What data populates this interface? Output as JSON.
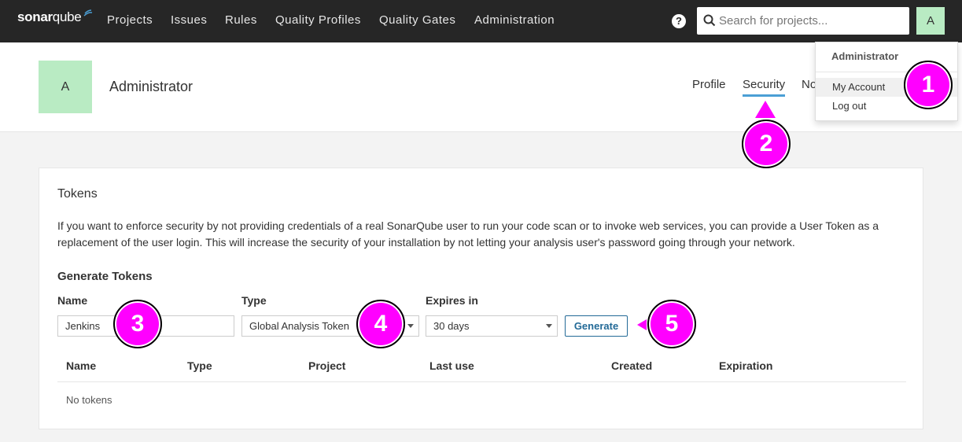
{
  "brand": {
    "name_bold": "sonar",
    "name_light": "qube"
  },
  "nav": [
    "Projects",
    "Issues",
    "Rules",
    "Quality Profiles",
    "Quality Gates",
    "Administration"
  ],
  "search": {
    "placeholder": "Search for projects..."
  },
  "user": {
    "initial": "A",
    "name": "Administrator"
  },
  "tabs": [
    "Profile",
    "Security",
    "No"
  ],
  "dropdown": {
    "header": "Administrator",
    "items": [
      "My Account",
      "Log out"
    ]
  },
  "tokens": {
    "title": "Tokens",
    "description": "If you want to enforce security by not providing credentials of a real SonarQube user to run your code scan or to invoke web services, you can provide a User Token as a replacement of the user login. This will increase the security of your installation by not letting your analysis user's password going through your network.",
    "generate_title": "Generate Tokens",
    "labels": {
      "name": "Name",
      "type": "Type",
      "expires": "Expires in"
    },
    "name_value": "Jenkins",
    "type_value": "Global Analysis Token",
    "expires_value": "30 days",
    "generate_label": "Generate",
    "columns": [
      "Name",
      "Type",
      "Project",
      "Last use",
      "Created",
      "Expiration"
    ],
    "empty_text": "No tokens"
  },
  "markers": [
    "1",
    "2",
    "3",
    "4",
    "5"
  ],
  "colors": {
    "topbar": "#262626",
    "avatar": "#b9ebc3",
    "accent": "#4b9fd5",
    "button": "#236a97",
    "marker": "#ff00ff"
  }
}
